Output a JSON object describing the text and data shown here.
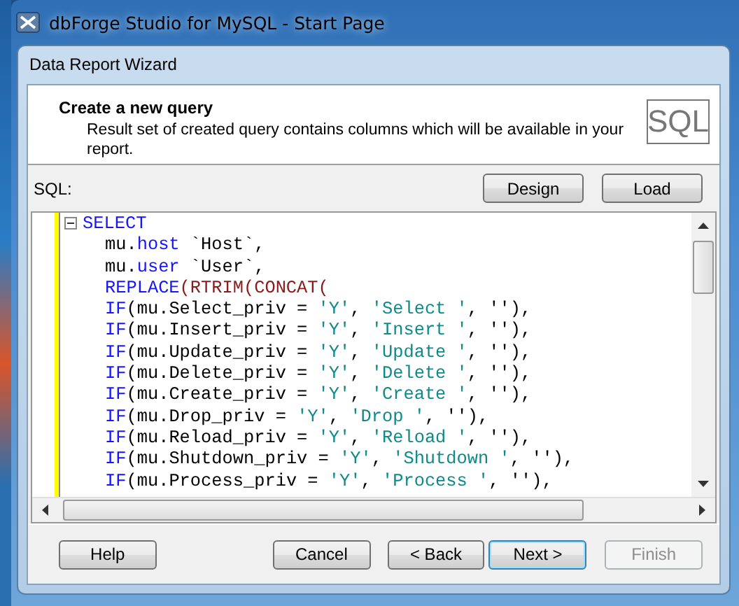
{
  "window": {
    "title": "dbForge Studio for MySQL - Start Page"
  },
  "dialog": {
    "title": "Data Report Wizard",
    "header": {
      "title": "Create a new query",
      "description": "Result set of created query contains columns which will be available in your report.",
      "badge": "SQL"
    },
    "sql_label": "SQL:",
    "sql_buttons": [
      "Design",
      "Load"
    ],
    "code_lines": [
      {
        "indented": false,
        "folded": false,
        "tokens": [
          {
            "kind": "keyword",
            "text": "SELECT"
          }
        ]
      },
      {
        "indented": true,
        "tokens": [
          {
            "kind": "plain",
            "text": "mu."
          },
          {
            "kind": "keyword",
            "text": "host"
          },
          {
            "kind": "plain",
            "text": " `Host`,"
          }
        ]
      },
      {
        "indented": true,
        "tokens": [
          {
            "kind": "plain",
            "text": "mu."
          },
          {
            "kind": "keyword",
            "text": "user"
          },
          {
            "kind": "plain",
            "text": " `User`,"
          }
        ]
      },
      {
        "indented": true,
        "tokens": [
          {
            "kind": "keyword",
            "text": "REPLACE"
          },
          {
            "kind": "function",
            "text": "(RTRIM(CONCAT("
          }
        ]
      },
      {
        "indented": true,
        "tokens": [
          {
            "kind": "keyword",
            "text": "IF"
          },
          {
            "kind": "plain",
            "text": "(mu.Select_priv = "
          },
          {
            "kind": "string",
            "text": "'Y'"
          },
          {
            "kind": "plain",
            "text": ", "
          },
          {
            "kind": "string",
            "text": "'Select '"
          },
          {
            "kind": "plain",
            "text": ", ''),"
          }
        ]
      },
      {
        "indented": true,
        "tokens": [
          {
            "kind": "keyword",
            "text": "IF"
          },
          {
            "kind": "plain",
            "text": "(mu.Insert_priv = "
          },
          {
            "kind": "string",
            "text": "'Y'"
          },
          {
            "kind": "plain",
            "text": ", "
          },
          {
            "kind": "string",
            "text": "'Insert '"
          },
          {
            "kind": "plain",
            "text": ", ''),"
          }
        ]
      },
      {
        "indented": true,
        "tokens": [
          {
            "kind": "keyword",
            "text": "IF"
          },
          {
            "kind": "plain",
            "text": "(mu.Update_priv = "
          },
          {
            "kind": "string",
            "text": "'Y'"
          },
          {
            "kind": "plain",
            "text": ", "
          },
          {
            "kind": "string",
            "text": "'Update '"
          },
          {
            "kind": "plain",
            "text": ", ''),"
          }
        ]
      },
      {
        "indented": true,
        "tokens": [
          {
            "kind": "keyword",
            "text": "IF"
          },
          {
            "kind": "plain",
            "text": "(mu.Delete_priv = "
          },
          {
            "kind": "string",
            "text": "'Y'"
          },
          {
            "kind": "plain",
            "text": ", "
          },
          {
            "kind": "string",
            "text": "'Delete '"
          },
          {
            "kind": "plain",
            "text": ", ''),"
          }
        ]
      },
      {
        "indented": true,
        "tokens": [
          {
            "kind": "keyword",
            "text": "IF"
          },
          {
            "kind": "plain",
            "text": "(mu.Create_priv = "
          },
          {
            "kind": "string",
            "text": "'Y'"
          },
          {
            "kind": "plain",
            "text": ", "
          },
          {
            "kind": "string",
            "text": "'Create '"
          },
          {
            "kind": "plain",
            "text": ", ''),"
          }
        ]
      },
      {
        "indented": true,
        "tokens": [
          {
            "kind": "keyword",
            "text": "IF"
          },
          {
            "kind": "plain",
            "text": "(mu.Drop_priv = "
          },
          {
            "kind": "string",
            "text": "'Y'"
          },
          {
            "kind": "plain",
            "text": ", "
          },
          {
            "kind": "string",
            "text": "'Drop '"
          },
          {
            "kind": "plain",
            "text": ", ''),"
          }
        ]
      },
      {
        "indented": true,
        "tokens": [
          {
            "kind": "keyword",
            "text": "IF"
          },
          {
            "kind": "plain",
            "text": "(mu.Reload_priv = "
          },
          {
            "kind": "string",
            "text": "'Y'"
          },
          {
            "kind": "plain",
            "text": ", "
          },
          {
            "kind": "string",
            "text": "'Reload '"
          },
          {
            "kind": "plain",
            "text": ", ''),"
          }
        ]
      },
      {
        "indented": true,
        "tokens": [
          {
            "kind": "keyword",
            "text": "IF"
          },
          {
            "kind": "plain",
            "text": "(mu.Shutdown_priv = "
          },
          {
            "kind": "string",
            "text": "'Y'"
          },
          {
            "kind": "plain",
            "text": ", "
          },
          {
            "kind": "string",
            "text": "'Shutdown '"
          },
          {
            "kind": "plain",
            "text": ", ''),"
          }
        ]
      },
      {
        "indented": true,
        "tokens": [
          {
            "kind": "keyword",
            "text": "IF"
          },
          {
            "kind": "plain",
            "text": "(mu.Process_priv = "
          },
          {
            "kind": "string",
            "text": "'Y'"
          },
          {
            "kind": "plain",
            "text": ", "
          },
          {
            "kind": "string",
            "text": "'Process '"
          },
          {
            "kind": "plain",
            "text": ", ''),"
          }
        ]
      }
    ],
    "footer_buttons": [
      {
        "label": "Help",
        "disabled": false,
        "default": false
      },
      {
        "label": "Cancel",
        "disabled": false,
        "default": false
      },
      {
        "label": "< Back",
        "disabled": false,
        "default": false
      },
      {
        "label": "Next >",
        "disabled": false,
        "default": true
      },
      {
        "label": "Finish",
        "disabled": true,
        "default": false
      }
    ]
  }
}
